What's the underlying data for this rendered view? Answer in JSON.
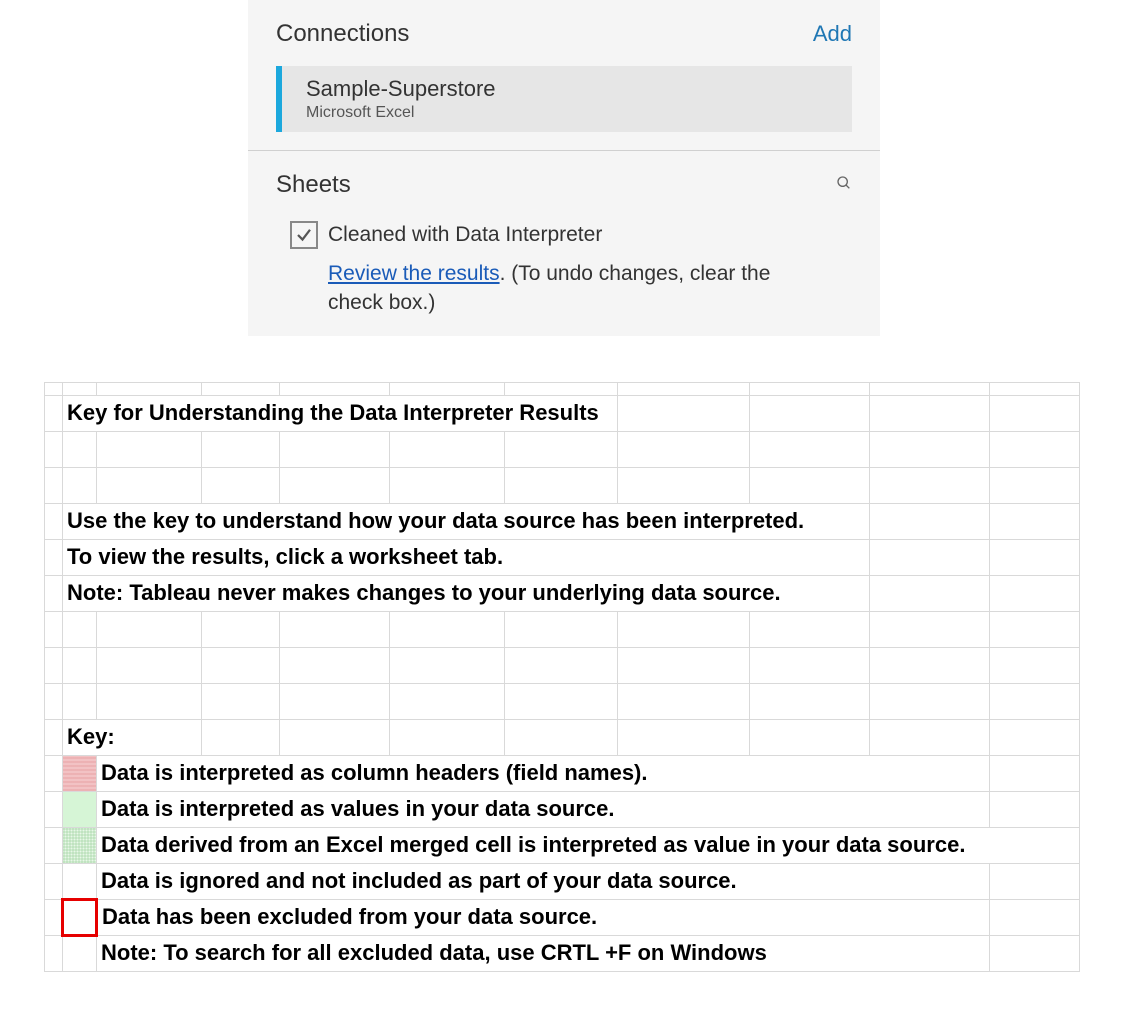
{
  "panel": {
    "connections_title": "Connections",
    "add_label": "Add",
    "connection": {
      "name": "Sample-Superstore",
      "type": "Microsoft Excel"
    },
    "sheets_title": "Sheets",
    "checkbox_label": "Cleaned with Data Interpreter",
    "review_link": "Review the results",
    "review_tail": ". (To undo changes, clear the check box.)"
  },
  "sheet": {
    "title_row": "Key for Understanding the Data Interpreter Results",
    "intro": [
      "Use the key to understand how your data source has been interpreted.",
      "To view the results, click a worksheet tab.",
      "Note: Tableau never makes changes to your underlying data source."
    ],
    "key_label": "Key:",
    "legend": [
      "Data is interpreted as column headers (field names).",
      "Data is interpreted as values in your data source.",
      "Data derived from an Excel merged cell is interpreted as value in your data source.",
      "Data is ignored and not included as part of your data source.",
      "Data has been excluded from your data source.",
      "Note: To search for all excluded data, use CRTL +F on Windows"
    ]
  }
}
